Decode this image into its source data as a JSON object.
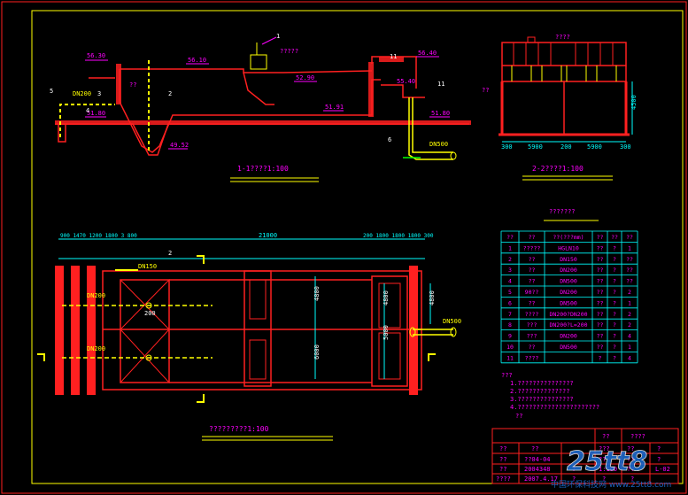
{
  "colors": {
    "background": "#000000",
    "structure": "#ff2020",
    "pipe": "#ffff00",
    "dimension": "#00ffff",
    "text": "#ffffff",
    "label": "#ff00ff",
    "accent_green": "#00ff00",
    "frame": "#ffff00"
  },
  "section1": {
    "title": "1-1????1:100",
    "levels": {
      "l1": "56.30",
      "l2": "56.10",
      "l3": "56.40",
      "l4": "55.40",
      "l5": "52.90",
      "l6": "51.80",
      "l7": "51.80",
      "l8": "51.91",
      "l9": "49.52"
    },
    "pipes": {
      "dn200": "DN200",
      "dn500": "DN500"
    },
    "callouts": {
      "c1": "1",
      "c2": "2",
      "c3": "3",
      "c4": "4",
      "c5": "5",
      "c6": "6",
      "c11": "11",
      "c11b": "11",
      "label_q": "??",
      "label_q5": "?????"
    }
  },
  "section2": {
    "title": "2-2????1:100",
    "top_label": "????",
    "side_label": "??",
    "height_dim": "4500",
    "dims": [
      "300",
      "5900",
      "200",
      "5900",
      "300"
    ]
  },
  "plan": {
    "title": "?????????1:100",
    "total": "21000",
    "left_dims": "900 1470 1200 1800 3 800",
    "right_dims": "200 1800 1800 1800 300",
    "pipes": {
      "dn150": "DN150",
      "dn200a": "DN200",
      "dn200b": "DN200",
      "dn500": "DN500",
      "dim200": "200"
    },
    "vertical_dims": [
      "4800",
      "6000",
      "4800",
      "5000",
      "4800"
    ],
    "callout2": "2"
  },
  "table": {
    "title": "???????",
    "headers": [
      "??",
      "??",
      "??(???mm)",
      "??",
      "??",
      "??"
    ],
    "rows": [
      [
        "1",
        "?????",
        "HGLN10",
        "??",
        "?",
        "1"
      ],
      [
        "2",
        "??",
        "DN150",
        "??",
        "?",
        "??"
      ],
      [
        "3",
        "??",
        "DN200",
        "??",
        "?",
        "??"
      ],
      [
        "4",
        "??",
        "DN500",
        "??",
        "?",
        "??"
      ],
      [
        "5",
        "90??",
        "DN200",
        "??",
        "?",
        "2"
      ],
      [
        "6",
        "??",
        "DN500",
        "??",
        "?",
        "1"
      ],
      [
        "7",
        "????",
        "DN200?DN200",
        "??",
        "?",
        "2"
      ],
      [
        "8",
        "???",
        "DN200?L=200",
        "??",
        "?",
        "2"
      ],
      [
        "9",
        "???",
        "DN200",
        "??",
        "?",
        "4"
      ],
      [
        "10",
        "??",
        "DN500",
        "??",
        "?",
        "1"
      ],
      [
        "11",
        "????",
        "",
        "?",
        "?",
        "4"
      ]
    ]
  },
  "notes": {
    "head": "???",
    "lines": [
      "1.???????????????",
      "2.??????????????",
      "3.???????????????",
      "4.??????????????????????",
      "??"
    ]
  },
  "title_block": {
    "r1": [
      "??",
      "????"
    ],
    "r2": [
      "??",
      "??",
      "???",
      "??",
      "?"
    ],
    "r3": [
      "??",
      "??04-04",
      "??",
      "??",
      "?"
    ],
    "r4": [
      "??",
      "2004348",
      "?",
      "1:100",
      "??",
      "L-02"
    ],
    "r5": [
      "????",
      "2007.4.17",
      "?",
      "?",
      "?"
    ]
  },
  "watermark": {
    "logo": "25tt8",
    "caption": "中国环保科技网 www.25tt8.com"
  }
}
